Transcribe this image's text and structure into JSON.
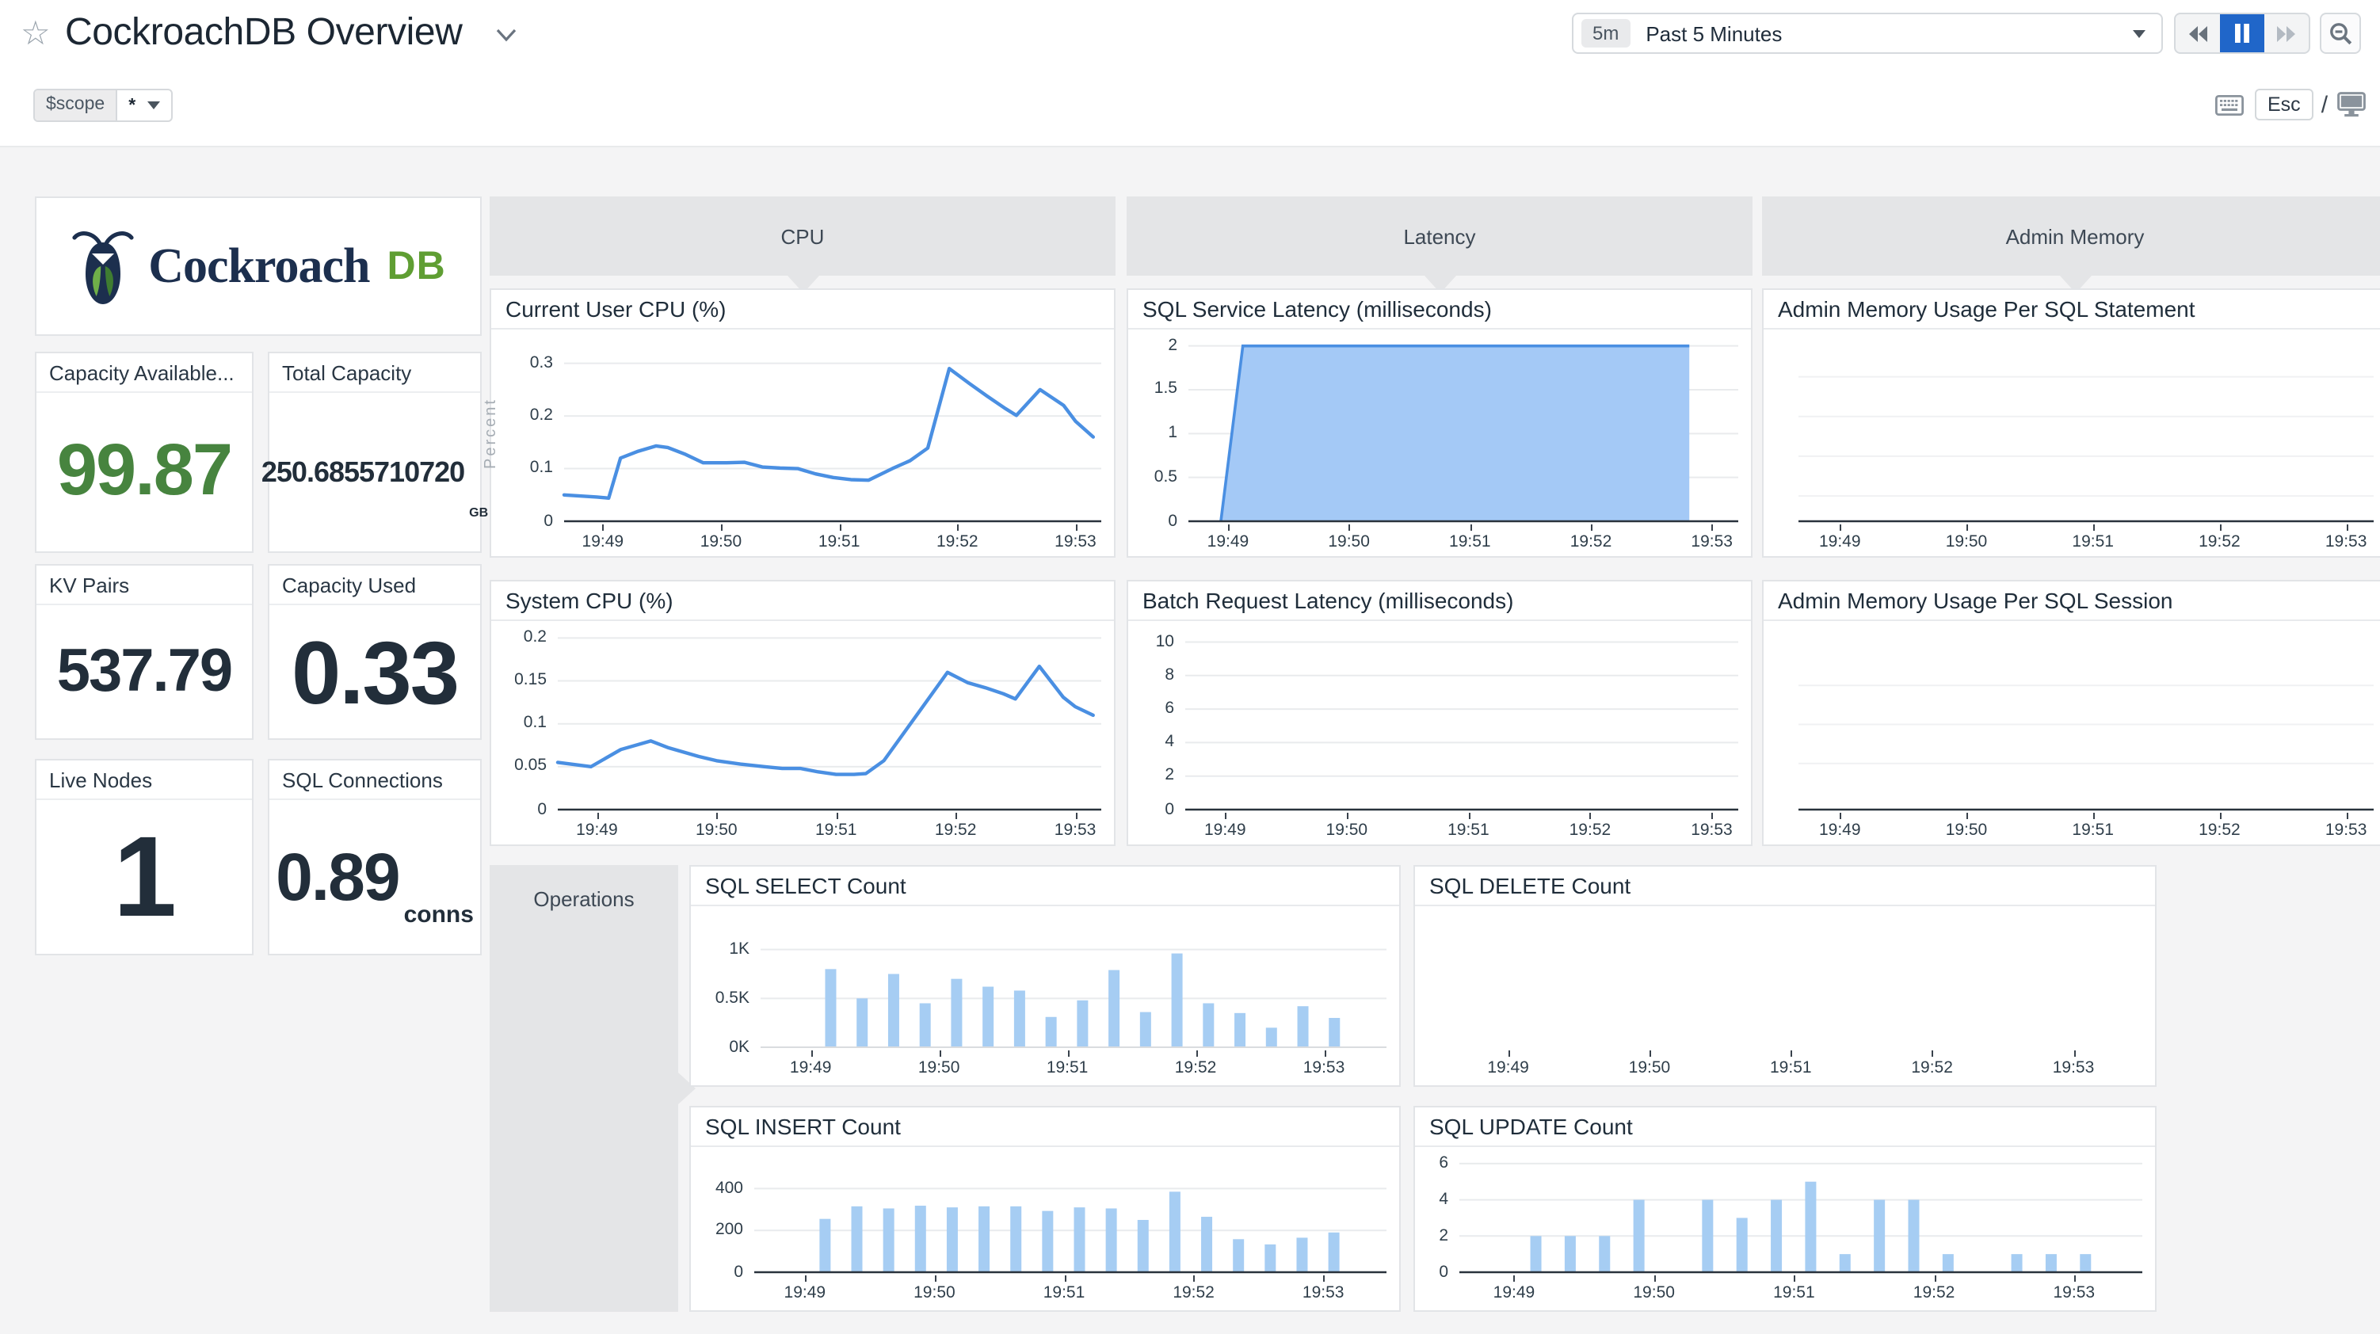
{
  "header": {
    "title": "CockroachDB Overview",
    "scope_label": "$scope",
    "scope_value": "*",
    "time_badge": "5m",
    "time_label": "Past 5 Minutes",
    "esc_label": "Esc",
    "slash": "/"
  },
  "logo": {
    "word": "Cockroach",
    "db": "DB"
  },
  "sections": {
    "cpu": "CPU",
    "latency": "Latency",
    "admin_memory": "Admin Memory",
    "operations": "Operations"
  },
  "stats": {
    "capacity_available": {
      "label": "Capacity Available...",
      "value": "99.87"
    },
    "total_capacity": {
      "label": "Total Capacity",
      "value": "250.6855710720",
      "unit": "GB"
    },
    "kv_pairs": {
      "label": "KV Pairs",
      "value": "537.79"
    },
    "capacity_used": {
      "label": "Capacity Used",
      "value": "0.33"
    },
    "live_nodes": {
      "label": "Live Nodes",
      "value": "1"
    },
    "sql_connections": {
      "label": "SQL Connections",
      "value": "0.89",
      "unit": "conns"
    }
  },
  "colors": {
    "line_blue": "#4a8fe2",
    "area_fill": "#a4c9f6",
    "bar_blue": "#a6cdf3",
    "pause_active_blue": "#2066c9",
    "value_green": "#47843f",
    "navy_text": "#1c2733",
    "tab_gray": "#e4e5e7"
  },
  "chart_data": {
    "user_cpu": {
      "type": "line",
      "title": "Current User CPU (%)",
      "ylabel": "Percent",
      "ymax": 0.325,
      "gutter": 46,
      "pad_top": 12,
      "pad_bottom": 22,
      "axis": "dark",
      "yticks": [
        {
          "v": 0,
          "label": "0"
        },
        {
          "v": 0.1,
          "label": "0.1"
        },
        {
          "v": 0.2,
          "label": "0.2"
        },
        {
          "v": 0.3,
          "label": "0.3"
        }
      ],
      "xticks": {
        "fracs": [
          0.072,
          0.292,
          0.512,
          0.732,
          0.952
        ],
        "labels": [
          "19:49",
          "19:50",
          "19:51",
          "19:52",
          "19:53"
        ]
      },
      "x": [
        0,
        0.061,
        0.083,
        0.105,
        0.138,
        0.171,
        0.193,
        0.226,
        0.259,
        0.303,
        0.336,
        0.369,
        0.402,
        0.435,
        0.468,
        0.501,
        0.534,
        0.567,
        0.611,
        0.644,
        0.677,
        0.717,
        0.754,
        0.787,
        0.82,
        0.842,
        0.886,
        0.93,
        0.952,
        0.985
      ],
      "y": [
        0.05,
        0.046,
        0.044,
        0.12,
        0.133,
        0.143,
        0.14,
        0.127,
        0.111,
        0.111,
        0.112,
        0.103,
        0.101,
        0.1,
        0.09,
        0.083,
        0.079,
        0.078,
        0.1,
        0.115,
        0.139,
        0.29,
        0.262,
        0.238,
        0.215,
        0.201,
        0.25,
        0.22,
        0.19,
        0.16
      ]
    },
    "system_cpu": {
      "type": "line",
      "title": "System CPU (%)",
      "ymax": 0.205,
      "gutter": 42,
      "pad_top": 7,
      "pad_bottom": 22,
      "axis": "dark",
      "yticks": [
        {
          "v": 0,
          "label": "0"
        },
        {
          "v": 0.05,
          "label": "0.05"
        },
        {
          "v": 0.1,
          "label": "0.1"
        },
        {
          "v": 0.15,
          "label": "0.15"
        },
        {
          "v": 0.2,
          "label": "0.2"
        }
      ],
      "xticks": {
        "fracs": [
          0.072,
          0.292,
          0.512,
          0.732,
          0.952
        ],
        "labels": [
          "19:49",
          "19:50",
          "19:51",
          "19:52",
          "19:53"
        ]
      },
      "x": [
        0,
        0.061,
        0.116,
        0.171,
        0.204,
        0.259,
        0.292,
        0.336,
        0.38,
        0.413,
        0.446,
        0.479,
        0.512,
        0.545,
        0.567,
        0.6,
        0.666,
        0.717,
        0.754,
        0.787,
        0.82,
        0.842,
        0.886,
        0.93,
        0.952,
        0.985
      ],
      "y": [
        0.055,
        0.05,
        0.07,
        0.08,
        0.072,
        0.062,
        0.057,
        0.053,
        0.05,
        0.048,
        0.048,
        0.044,
        0.041,
        0.041,
        0.042,
        0.057,
        0.115,
        0.16,
        0.148,
        0.142,
        0.135,
        0.129,
        0.167,
        0.131,
        0.12,
        0.11
      ]
    },
    "sql_latency": {
      "type": "area",
      "title": "SQL Service Latency (milliseconds)",
      "ymax": 2.06,
      "gutter": 38,
      "pad_top": 6,
      "pad_bottom": 22,
      "axis": "dark",
      "yticks": [
        {
          "v": 0,
          "label": "0"
        },
        {
          "v": 0.5,
          "label": "0.5"
        },
        {
          "v": 1,
          "label": "1"
        },
        {
          "v": 1.5,
          "label": "1.5"
        },
        {
          "v": 2,
          "label": "2"
        }
      ],
      "xticks": {
        "fracs": [
          0.072,
          0.292,
          0.512,
          0.732,
          0.952
        ],
        "labels": [
          "19:49",
          "19:50",
          "19:51",
          "19:52",
          "19:53"
        ]
      },
      "area": [
        [
          0.059,
          0
        ],
        [
          0.099,
          2
        ],
        [
          0.911,
          2
        ],
        [
          0.911,
          0
        ]
      ],
      "edge": [
        [
          0.059,
          0
        ],
        [
          0.099,
          2
        ],
        [
          0.911,
          2
        ]
      ]
    },
    "batch_latency": {
      "type": "empty",
      "title": "Batch Request Latency (milliseconds)",
      "ymax": 10.4,
      "gutter": 36,
      "pad_top": 8,
      "pad_bottom": 22,
      "axis": "dark",
      "yticks": [
        {
          "v": 0,
          "label": "0"
        },
        {
          "v": 2,
          "label": "2"
        },
        {
          "v": 4,
          "label": "4"
        },
        {
          "v": 6,
          "label": "6"
        },
        {
          "v": 8,
          "label": "8"
        },
        {
          "v": 10,
          "label": "10"
        }
      ],
      "xticks": {
        "fracs": [
          0.072,
          0.292,
          0.512,
          0.732,
          0.952
        ],
        "labels": [
          "19:49",
          "19:50",
          "19:51",
          "19:52",
          "19:53"
        ]
      }
    },
    "admin_stmt": {
      "type": "empty",
      "title": "Admin Memory Usage Per SQL Statement",
      "ymax": 1,
      "gutter": 22,
      "pad_top": 6,
      "pad_bottom": 22,
      "axis": "dark",
      "grid_color": "#f0f1f3",
      "hlines": [
        0.2,
        0.42,
        0.64,
        0.86
      ],
      "xticks": {
        "fracs": [
          0.072,
          0.292,
          0.512,
          0.732,
          0.952
        ],
        "labels": [
          "19:49",
          "19:50",
          "19:51",
          "19:52",
          "19:53"
        ]
      }
    },
    "admin_sess": {
      "type": "empty",
      "title": "Admin Memory Usage Per SQL Session",
      "ymax": 1,
      "gutter": 22,
      "pad_top": 6,
      "pad_bottom": 22,
      "axis": "dark",
      "grid_color": "#f0f1f3",
      "hlines": [
        0.3,
        0.52,
        0.74
      ],
      "xticks": {
        "fracs": [
          0.072,
          0.292,
          0.512,
          0.732,
          0.952
        ],
        "labels": [
          "19:49",
          "19:50",
          "19:51",
          "19:52",
          "19:53"
        ]
      }
    },
    "sql_select": {
      "type": "bars",
      "title": "SQL SELECT Count",
      "ymax": 1.2,
      "gutter": 44,
      "pad_top": 14,
      "pad_bottom": 24,
      "axis": "light",
      "yticks": [
        {
          "v": 0,
          "label": "0K"
        },
        {
          "v": 0.5,
          "label": "0.5K"
        },
        {
          "v": 1,
          "label": "1K"
        }
      ],
      "xticks": {
        "fracs": [
          0.08,
          0.285,
          0.49,
          0.695,
          0.9
        ],
        "labels": [
          "19:49",
          "19:50",
          "19:51",
          "19:52",
          "19:53"
        ]
      },
      "bar_start": 0.112,
      "bar_step": 0.0503,
      "values": [
        0.8,
        0.5,
        0.75,
        0.45,
        0.7,
        0.62,
        0.58,
        0.31,
        0.48,
        0.79,
        0.36,
        0.96,
        0.45,
        0.35,
        0.2,
        0.42,
        0.3
      ]
    },
    "sql_delete": {
      "type": "empty",
      "title": "SQL DELETE Count",
      "ymax": 1,
      "gutter": 24,
      "pad_top": 8,
      "pad_bottom": 24,
      "axis": "none",
      "xticks": {
        "fracs": [
          0.08,
          0.285,
          0.49,
          0.695,
          0.9
        ],
        "labels": [
          "19:49",
          "19:50",
          "19:51",
          "19:52",
          "19:53"
        ]
      }
    },
    "sql_insert": {
      "type": "bars",
      "title": "SQL INSERT Count",
      "ymax": 500,
      "gutter": 40,
      "pad_top": 12,
      "pad_bottom": 24,
      "axis": "dark",
      "yticks": [
        {
          "v": 0,
          "label": "0"
        },
        {
          "v": 200,
          "label": "200"
        },
        {
          "v": 400,
          "label": "400"
        }
      ],
      "xticks": {
        "fracs": [
          0.08,
          0.285,
          0.49,
          0.695,
          0.9
        ],
        "labels": [
          "19:49",
          "19:50",
          "19:51",
          "19:52",
          "19:53"
        ]
      },
      "bar_start": 0.112,
      "bar_step": 0.0503,
      "values": [
        255,
        315,
        305,
        318,
        310,
        315,
        315,
        293,
        310,
        305,
        250,
        385,
        265,
        158,
        133,
        165,
        190
      ]
    },
    "sql_update": {
      "type": "bars",
      "title": "SQL UPDATE Count",
      "ymax": 6.3,
      "gutter": 28,
      "pad_top": 6,
      "pad_bottom": 24,
      "axis": "dark",
      "yticks": [
        {
          "v": 0,
          "label": "0"
        },
        {
          "v": 2,
          "label": "2"
        },
        {
          "v": 4,
          "label": "4"
        },
        {
          "v": 6,
          "label": "6"
        }
      ],
      "xticks": {
        "fracs": [
          0.08,
          0.285,
          0.49,
          0.695,
          0.9
        ],
        "labels": [
          "19:49",
          "19:50",
          "19:51",
          "19:52",
          "19:53"
        ]
      },
      "bar_start": 0.112,
      "bar_step": 0.0503,
      "values": [
        2,
        2,
        2,
        4,
        0,
        4,
        3,
        4,
        5,
        1,
        4,
        4,
        1,
        0,
        1,
        1,
        1
      ]
    }
  }
}
